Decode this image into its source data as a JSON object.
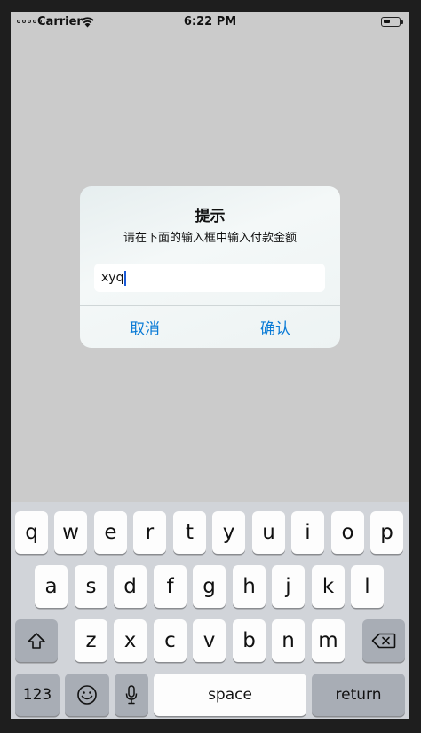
{
  "status_bar": {
    "carrier": "Carrier",
    "time": "6:22 PM"
  },
  "alert": {
    "title": "提示",
    "message": "请在下面的输入框中输入付款金额",
    "input_value": "xyq",
    "cancel_label": "取消",
    "confirm_label": "确认"
  },
  "keyboard": {
    "row1": [
      "q",
      "w",
      "e",
      "r",
      "t",
      "y",
      "u",
      "i",
      "o",
      "p"
    ],
    "row2": [
      "a",
      "s",
      "d",
      "f",
      "g",
      "h",
      "j",
      "k",
      "l"
    ],
    "row3": [
      "z",
      "x",
      "c",
      "v",
      "b",
      "n",
      "m"
    ],
    "numbers_label": "123",
    "space_label": "space",
    "return_label": "return"
  },
  "colors": {
    "accent": "#0a7bd6",
    "caret": "#1a5ad6"
  }
}
